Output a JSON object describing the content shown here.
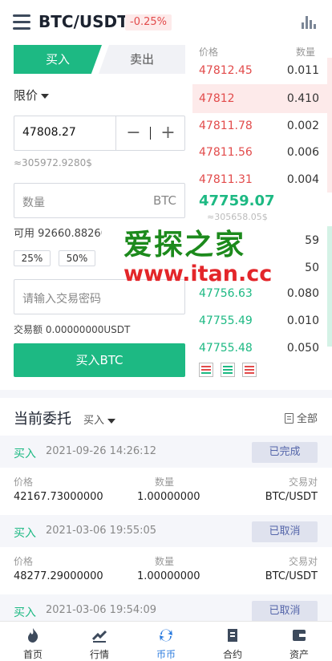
{
  "header": {
    "pair": "BTC/USDT",
    "change": "-0.25%"
  },
  "trade": {
    "tab_buy": "买入",
    "tab_sell": "卖出",
    "order_type": "限价",
    "price_value": "47808.27",
    "minus": "−",
    "plus": "+",
    "approx": "≈305972.9280$",
    "qty_placeholder": "数量",
    "qty_unit": "BTC",
    "available": "可用 92660.88260",
    "percents": [
      "25%",
      "50%"
    ],
    "password_placeholder": "请输入交易密码",
    "turnover": "交易额 0.00000000USDT",
    "buy_button": "买入BTC"
  },
  "orderbook": {
    "head_price": "价格",
    "head_qty": "数量",
    "asks": [
      {
        "price": "47812.45",
        "qty": "0.011"
      },
      {
        "price": "47812",
        "qty": "0.410"
      },
      {
        "price": "47811.78",
        "qty": "0.002"
      },
      {
        "price": "47811.56",
        "qty": "0.006"
      },
      {
        "price": "47811.31",
        "qty": "0.004"
      }
    ],
    "mid_price": "47759.07",
    "mid_sub": "≈305658.05$",
    "bids": [
      {
        "price": "47756.63",
        "qty": "0.080"
      },
      {
        "price": "47755.49",
        "qty": "0.010"
      },
      {
        "price": "47755.48",
        "qty": "0.050"
      }
    ],
    "bid_partial_qty": [
      "59",
      "50"
    ]
  },
  "watermark": {
    "title": "爱探之家",
    "url": "www.itan.cc"
  },
  "orders": {
    "title": "当前委托",
    "filter": "买入",
    "all": "全部",
    "col_price": "价格",
    "col_qty": "数量",
    "col_pair": "交易对",
    "items": [
      {
        "side": "买入",
        "time": "2021-09-26 14:26:12",
        "status": "已完成",
        "price": "42167.73000000",
        "qty": "1.00000000",
        "pair": "BTC/USDT"
      },
      {
        "side": "买入",
        "time": "2021-03-06 19:55:05",
        "status": "已取消",
        "price": "48277.29000000",
        "qty": "1.00000000",
        "pair": "BTC/USDT"
      },
      {
        "side": "买入",
        "time": "2021-03-06 19:54:09",
        "status": "已取消"
      }
    ]
  },
  "nav": {
    "items": [
      "首页",
      "行情",
      "币币",
      "合约",
      "资产"
    ]
  },
  "colors": {
    "green": "#1db983",
    "red": "#e24b4b",
    "active_nav": "#2b7bde"
  }
}
